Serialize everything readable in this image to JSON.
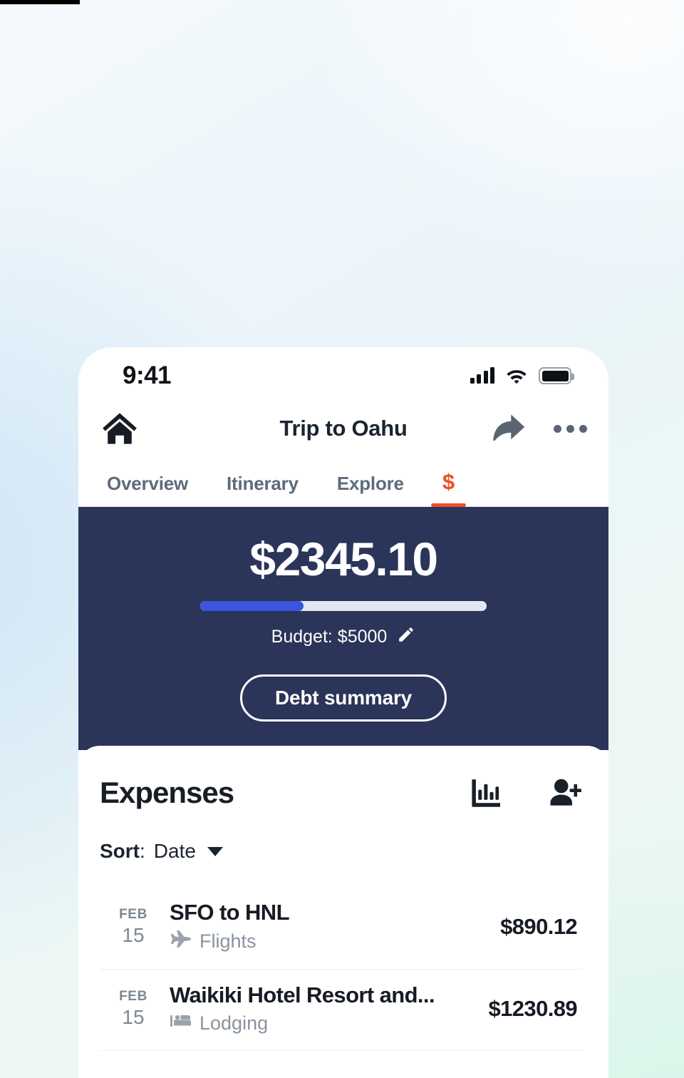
{
  "status_bar": {
    "time": "9:41",
    "signal_icon": "cellular-signal-icon",
    "wifi_icon": "wifi-icon",
    "battery_icon": "battery-icon"
  },
  "nav": {
    "home_icon": "home-icon",
    "title": "Trip to Oahu",
    "share_icon": "share-icon",
    "more_icon": "more-options-icon"
  },
  "tabs": [
    {
      "label": "Overview",
      "active": false
    },
    {
      "label": "Itinerary",
      "active": false
    },
    {
      "label": "Explore",
      "active": false
    },
    {
      "label": "$",
      "active": true
    }
  ],
  "summary": {
    "total": "$2345.10",
    "budget_label": "Budget: $5000",
    "edit_icon": "pencil-edit-icon",
    "progress_percent": 36,
    "debt_button": "Debt summary",
    "panel_color": "#2b3459",
    "progress_fill_color": "#3b55e0",
    "progress_track_color": "#e4e7f2"
  },
  "expenses_section": {
    "title": "Expenses",
    "chart_icon": "bar-chart-icon",
    "add_person_icon": "add-person-icon",
    "sort_label": "Sort",
    "sort_separator": ": ",
    "sort_value": "Date",
    "sort_caret_icon": "chevron-down-icon"
  },
  "expenses": [
    {
      "month": "FEB",
      "day": "15",
      "name": "SFO to HNL",
      "category": "Flights",
      "category_icon": "airplane-icon",
      "amount": "$890.12"
    },
    {
      "month": "FEB",
      "day": "15",
      "name": "Waikiki Hotel Resort and...",
      "category": "Lodging",
      "category_icon": "bed-icon",
      "amount": "$1230.89"
    }
  ],
  "theme": {
    "accent": "#f04e23",
    "navy": "#2b3459",
    "tab_inactive": "#5d6b7d"
  }
}
